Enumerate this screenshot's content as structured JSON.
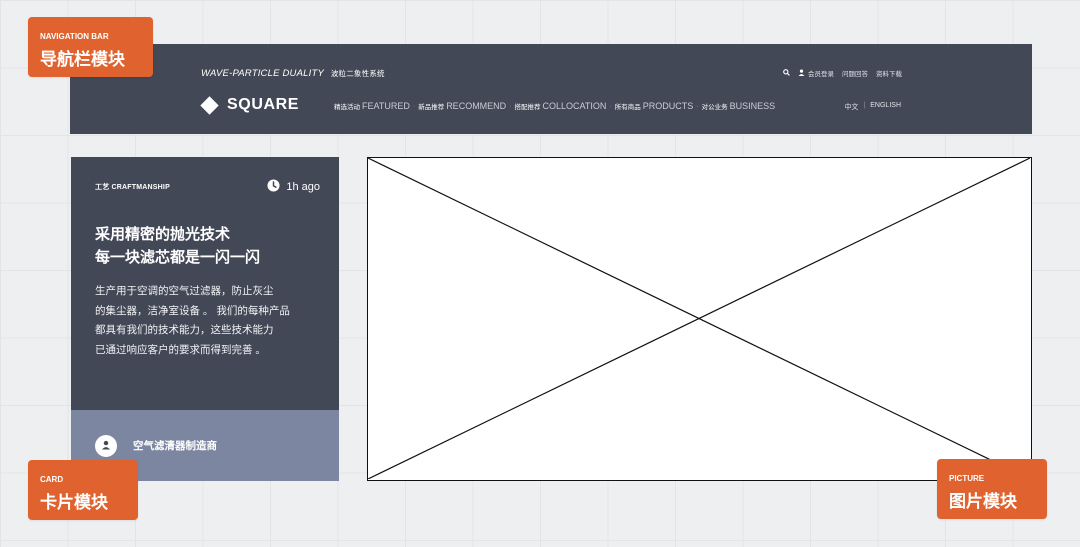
{
  "nav": {
    "tagline_en": "WAVE-PARTICLE DUALITY",
    "tagline_zh": "波粒二象性系统",
    "search_icon": "search-icon",
    "login_label": "会员登录",
    "faq_label": "问题回答",
    "download_label": "资料下载",
    "logo_text": "SQUARE",
    "menu": [
      {
        "zh": "精选活动",
        "en": "FEATURED"
      },
      {
        "zh": "新品推荐",
        "en": "RECOMMEND"
      },
      {
        "zh": "搭配推荐",
        "en": "COLLOCATION"
      },
      {
        "zh": "所有商品",
        "en": "PRODUCTS"
      },
      {
        "zh": "对公业务",
        "en": "BUSINESS"
      }
    ],
    "separator": "·",
    "lang_zh": "中文",
    "lang_divider": "|",
    "lang_en": "ENGLISH"
  },
  "card": {
    "category": "工艺 CRAFTMANSHIP",
    "time": "1h ago",
    "title_lines": [
      "采用精密的抛光技术",
      "每一块滤芯都是一闪一闪"
    ],
    "body_lines": [
      "生产用于空调的空气过滤器，防止灰尘",
      "的集尘器，洁净室设备 。 我们的每种产品",
      "都具有我们的技术能力，这些技术能力",
      "已通过响应客户的要求而得到完善 。"
    ],
    "author": "空气滤清器制造商",
    "avatar_icon": "user-icon",
    "clock_icon": "clock-icon"
  },
  "labels": {
    "nav_en": "NAVIGATION BAR",
    "nav_zh": "导航栏模块",
    "card_en": "CARD",
    "card_zh": "卡片模块",
    "picture_en": "PICTURE",
    "picture_zh": "图片模块"
  },
  "colors": {
    "nav_bg": "#434857",
    "card_footer_bg": "#7c86a1",
    "label_orange": "#e0632f"
  }
}
